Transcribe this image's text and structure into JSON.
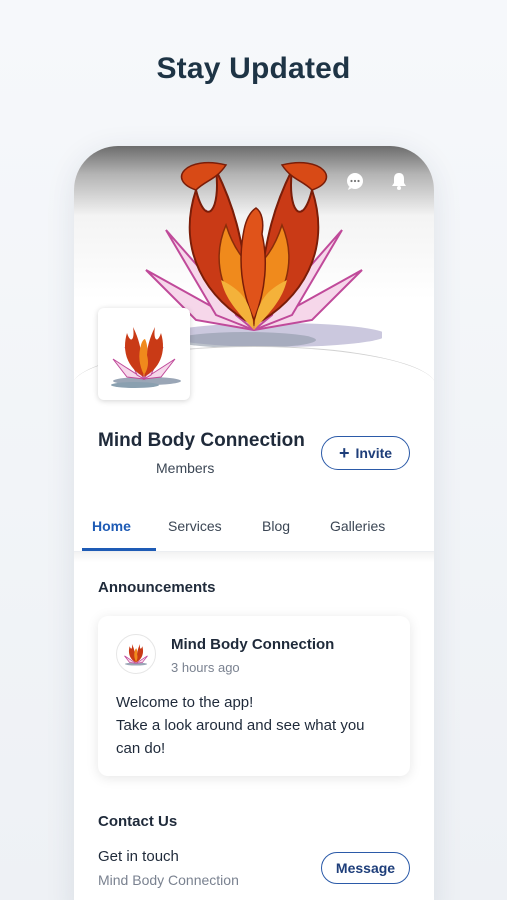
{
  "heading": "Stay Updated",
  "header_icons": [
    "chat-icon",
    "bell-icon"
  ],
  "site": {
    "name": "Mind Body Connection",
    "members_label": "Members",
    "invite_label": "Invite"
  },
  "tabs": [
    {
      "label": "Home",
      "active": true
    },
    {
      "label": "Services",
      "active": false
    },
    {
      "label": "Blog",
      "active": false
    },
    {
      "label": "Galleries",
      "active": false
    }
  ],
  "announcements": {
    "title": "Announcements",
    "post": {
      "author": "Mind Body Connection",
      "time": "3 hours ago",
      "body_lines": [
        "Welcome to the app!",
        "Take a look around and see what you",
        "can do!"
      ]
    }
  },
  "contact": {
    "title": "Contact Us",
    "text": "Get in touch",
    "subtext": "Mind Body Connection",
    "button_label": "Message"
  },
  "colors": {
    "accent": "#1e5bb5",
    "button_border": "#2b5aa8",
    "heading": "#1e3445"
  }
}
